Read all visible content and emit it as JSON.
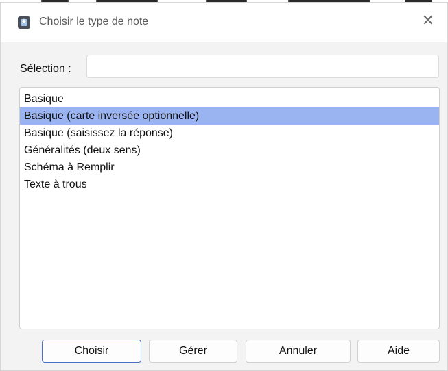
{
  "window": {
    "title": "Choisir le type de note",
    "close_glyph": "✕",
    "icon": "app-icon"
  },
  "selection": {
    "label": "Sélection :",
    "value": "",
    "placeholder": ""
  },
  "note_types": [
    {
      "label": "Basique",
      "selected": false
    },
    {
      "label": "Basique (carte inversée optionnelle)",
      "selected": true
    },
    {
      "label": "Basique (saisissez la réponse)",
      "selected": false
    },
    {
      "label": "Généralités (deux sens)",
      "selected": false
    },
    {
      "label": "Schéma à Remplir",
      "selected": false
    },
    {
      "label": "Texte à trous",
      "selected": false
    }
  ],
  "buttons": {
    "choose": "Choisir",
    "manage": "Gérer",
    "cancel": "Annuler",
    "help": "Aide"
  },
  "colors": {
    "selection_highlight": "#99b4f0",
    "primary_button_border": "#4a6fc0"
  }
}
